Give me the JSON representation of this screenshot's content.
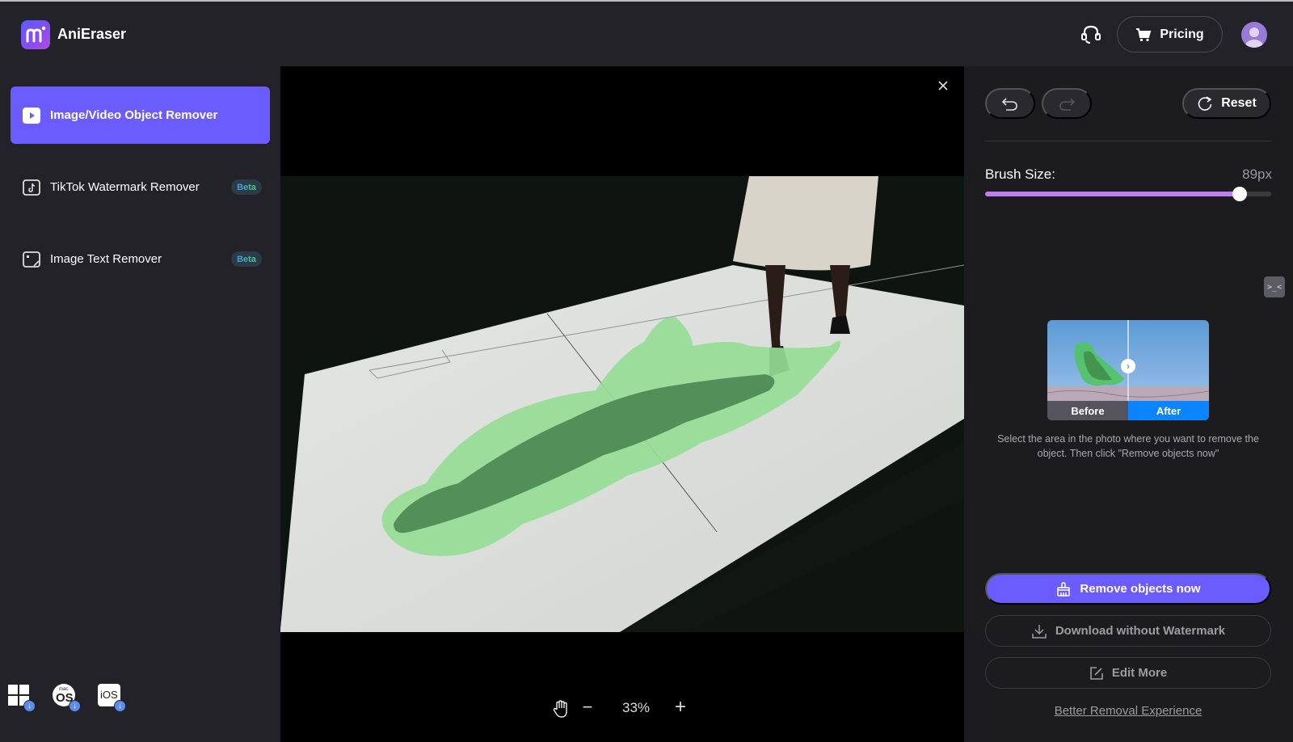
{
  "app": {
    "title": "AniEraser",
    "brand_color": "#6b5cff"
  },
  "header": {
    "support_icon": "headset-icon",
    "pricing_label": "Pricing",
    "pricing_icon": "cart-icon",
    "avatar_icon": "user-avatar-icon"
  },
  "sidebar": {
    "items": [
      {
        "label": "Image/Video Object Remover",
        "icon": "play-icon",
        "active": true,
        "badge": ""
      },
      {
        "label": "TikTok Watermark Remover",
        "icon": "tiktok-icon",
        "active": false,
        "badge": "Beta"
      },
      {
        "label": "Image Text Remover",
        "icon": "image-text-icon",
        "active": false,
        "badge": "Beta"
      }
    ],
    "platforms": [
      {
        "name": "Windows",
        "icon": "windows-download-icon",
        "label": ""
      },
      {
        "name": "macOS",
        "icon": "macos-download-icon",
        "label": "OS",
        "sublabel": "mac"
      },
      {
        "name": "iOS",
        "icon": "ios-download-icon",
        "label": "iOS"
      }
    ]
  },
  "canvas": {
    "close_icon": "close-icon",
    "zoom": {
      "hand_icon": "hand-pan-icon",
      "minus": "−",
      "level": "33%",
      "plus": "+"
    }
  },
  "panel": {
    "undo_icon": "undo-icon",
    "redo_icon": "redo-icon",
    "reset_label": "Reset",
    "brush_label": "Brush Size:",
    "brush_value": "89px",
    "brush_fraction": 0.89,
    "side_tab": ">_<",
    "preview": {
      "before_label": "Before",
      "after_label": "After",
      "handle": "›"
    },
    "hint": "Select the area in the photo where you want to remove the object. Then click \"Remove objects now\"",
    "remove_label": "Remove objects now",
    "download_label": "Download without Watermark",
    "edit_label": "Edit More",
    "better_link": "Better Removal Experience"
  }
}
